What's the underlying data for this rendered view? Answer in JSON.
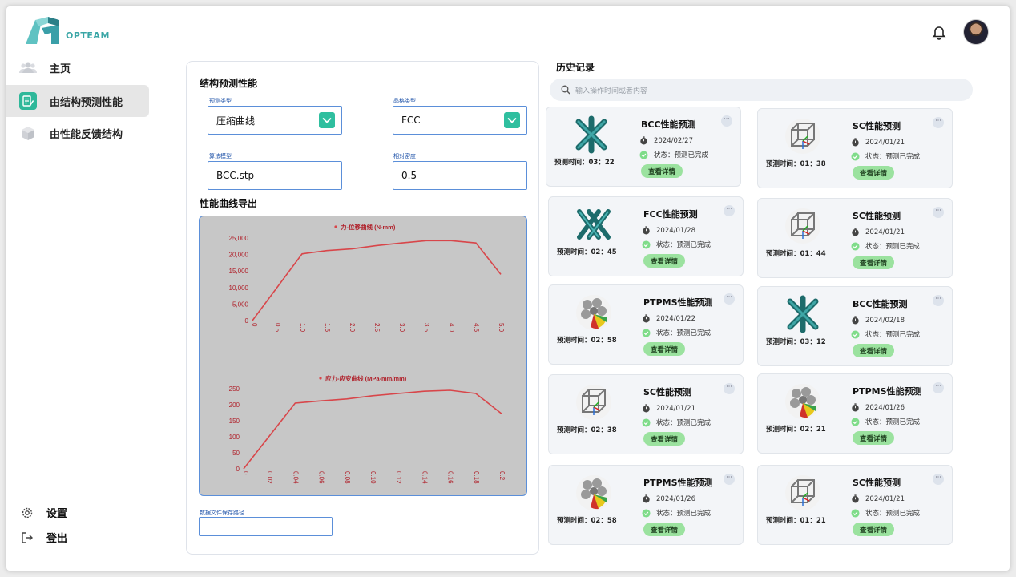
{
  "app": {
    "brand": "OPTEAM"
  },
  "sidebar": {
    "items": [
      {
        "label": "主页",
        "icon": "users-icon"
      },
      {
        "label": "由结构预测性能",
        "icon": "edit-doc-icon",
        "active": true
      },
      {
        "label": "由性能反馈结构",
        "icon": "cube-icon"
      }
    ],
    "footer": [
      {
        "label": "设置",
        "icon": "gear-icon"
      },
      {
        "label": "登出",
        "icon": "logout-icon"
      }
    ]
  },
  "form": {
    "title": "结构预测性能",
    "predict_type": {
      "label": "预测类型",
      "value": "压缩曲线"
    },
    "lattice_type": {
      "label": "晶格类型",
      "value": "FCC"
    },
    "algo_model": {
      "label": "算法模型",
      "value": "BCC.stp"
    },
    "density": {
      "label": "相对密度",
      "value": "0.5"
    },
    "curves_title": "性能曲线导出",
    "save_path": {
      "label": "数据文件保存路径",
      "value": ""
    }
  },
  "chart_data": [
    {
      "type": "line",
      "title": "力-位移曲线 (N-mm)",
      "series": [
        {
          "name": "",
          "color": "#d8464a",
          "x": [
            0,
            1.0,
            1.5,
            2.0,
            2.5,
            3.0,
            3.5,
            4.0,
            4.5,
            5.0
          ],
          "values": [
            0,
            20200,
            21200,
            21700,
            22700,
            23500,
            24200,
            24200,
            23500,
            14000
          ]
        }
      ],
      "x_ticks": [
        "0",
        "0.5",
        "1.0",
        "1.5",
        "2.0",
        "2.5",
        "3.0",
        "3.5",
        "4.0",
        "4.5",
        "5.0"
      ],
      "y_ticks": [
        "0",
        "5,000",
        "10,000",
        "15,000",
        "20,000",
        "25,000"
      ],
      "xlim": [
        0,
        5.0
      ],
      "ylim": [
        0,
        25000
      ],
      "grid": false
    },
    {
      "type": "line",
      "title": "应力-应变曲线 (MPa-mm/mm)",
      "series": [
        {
          "name": "",
          "color": "#d8464a",
          "x": [
            0,
            0.04,
            0.06,
            0.08,
            0.1,
            0.12,
            0.14,
            0.16,
            0.18,
            0.2
          ],
          "values": [
            0,
            205,
            212,
            218,
            228,
            235,
            242,
            245,
            235,
            172
          ]
        }
      ],
      "x_ticks": [
        "0",
        "0.02",
        "0.04",
        "0.06",
        "0.08",
        "0.10",
        "0.12",
        "0.14",
        "0.16",
        "0.18",
        "0.2"
      ],
      "y_ticks": [
        "0",
        "50",
        "100",
        "150",
        "200",
        "250"
      ],
      "xlim": [
        0,
        0.2
      ],
      "ylim": [
        0,
        250
      ],
      "grid": false
    }
  ],
  "history": {
    "title": "历史记录",
    "search_placeholder": "输入操作时间或者内容",
    "status_prefix": "状态：",
    "details_label": "查看详情",
    "cards": [
      {
        "title": "BCC性能预测",
        "date": "2024/02/27",
        "status": "预测已完成",
        "time": "预测时间：03：22",
        "thumb": "bcc"
      },
      {
        "title": "SC性能预测",
        "date": "2024/01/21",
        "status": "预测已完成",
        "time": "预测时间：01：38",
        "thumb": "sc"
      },
      {
        "title": "FCC性能预测",
        "date": "2024/01/28",
        "status": "预测已完成",
        "time": "预测时间：02：45",
        "thumb": "fcc"
      },
      {
        "title": "SC性能预测",
        "date": "2024/01/21",
        "status": "预测已完成",
        "time": "预测时间：01：44",
        "thumb": "sc"
      },
      {
        "title": "PTPMS性能预测",
        "date": "2024/01/22",
        "status": "预测已完成",
        "time": "预测时间：02：58",
        "thumb": "ptpms"
      },
      {
        "title": "BCC性能预测",
        "date": "2024/02/18",
        "status": "预测已完成",
        "time": "预测时间：03：12",
        "thumb": "bcc"
      },
      {
        "title": "SC性能预测",
        "date": "2024/01/21",
        "status": "预测已完成",
        "time": "预测时间：02：38",
        "thumb": "sc"
      },
      {
        "title": "PTPMS性能预测",
        "date": "2024/01/26",
        "status": "预测已完成",
        "time": "预测时间：02：21",
        "thumb": "ptpms"
      },
      {
        "title": "PTPMS性能预测",
        "date": "2024/01/26",
        "status": "预测已完成",
        "time": "预测时间：02：58",
        "thumb": "ptpms"
      },
      {
        "title": "SC性能预测",
        "date": "2024/01/21",
        "status": "预测已完成",
        "time": "预测时间：01：21",
        "thumb": "sc"
      }
    ]
  }
}
